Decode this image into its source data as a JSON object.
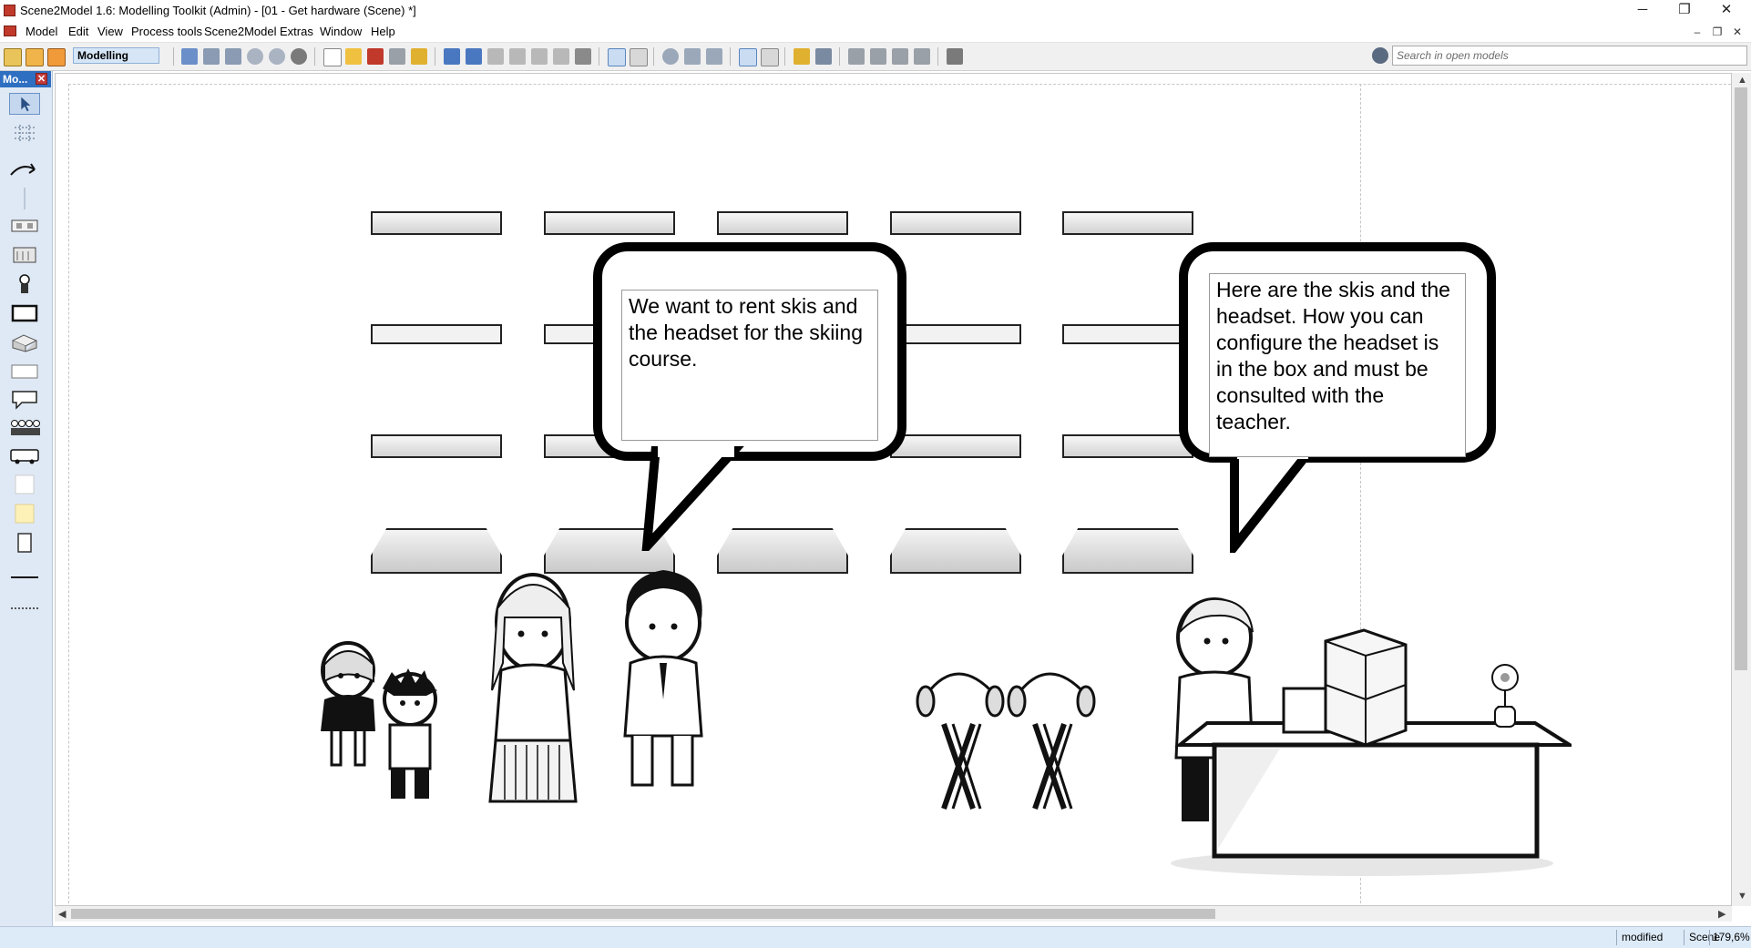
{
  "window": {
    "title": "Scene2Model 1.6: Modelling Toolkit (Admin) - [01 - Get hardware (Scene) *]",
    "minimize": "─",
    "restore": "❐",
    "close": "✕"
  },
  "menu": {
    "items": [
      "Model",
      "Edit",
      "View",
      "Process tools",
      "Scene2Model",
      "Extras",
      "Window",
      "Help"
    ],
    "mdi_minimize": "–",
    "mdi_restore": "❐",
    "mdi_close": "✕"
  },
  "toolbar": {
    "mode": "Modelling",
    "search_placeholder": "Search in open models"
  },
  "palette": {
    "title": "Mo...",
    "close": "✕"
  },
  "scene": {
    "bubble_left": "We want to rent skis and the headset for the skiing course.",
    "bubble_right": "Here are the skis and the headset. How you can configure the headset is in the box and must be consulted with the teacher."
  },
  "status": {
    "state": "modified",
    "type": "Scene",
    "zoom": "179,6%"
  },
  "colors": {
    "palette_bg": "#dfe9f5",
    "palette_header": "#2f6fc1",
    "status_bg": "#ddeaf7"
  }
}
